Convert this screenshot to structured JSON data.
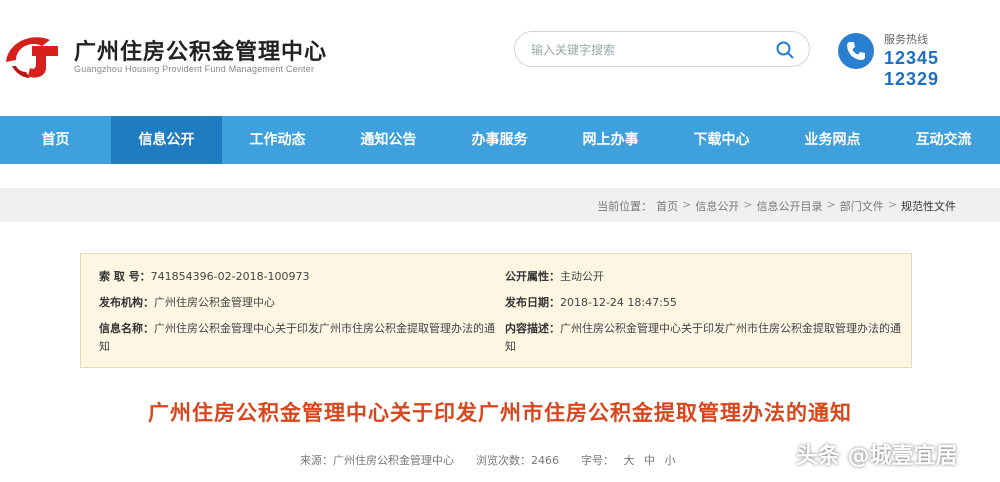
{
  "header": {
    "title": "广州住房公积金管理中心",
    "subtitle": "Guangzhou Housing Provident Fund Management Center",
    "search_placeholder": "输入关键字搜索",
    "hotline_label": "服务热线",
    "hotline_number": "12345 12329"
  },
  "nav": {
    "items": [
      "首页",
      "信息公开",
      "工作动态",
      "通知公告",
      "办事服务",
      "网上办事",
      "下载中心",
      "业务网点",
      "互动交流"
    ],
    "active": "信息公开"
  },
  "breadcrumb": {
    "prefix": "当前位置：",
    "items": [
      "首页",
      "信息公开",
      "信息公开目录",
      "部门文件",
      "规范性文件"
    ]
  },
  "info": {
    "index_label": "索 取 号：",
    "index_value": "741854396-02-2018-100973",
    "attr_label": "公开属性：",
    "attr_value": "主动公开",
    "org_label": "发布机构：",
    "org_value": "广州住房公积金管理中心",
    "date_label": "发布日期：",
    "date_value": "2018-12-24 18:47:55",
    "name_label": "信息名称：",
    "name_value": "广州住房公积金管理中心关于印发广州市住房公积金提取管理办法的通知",
    "desc_label": "内容描述：",
    "desc_value": "广州住房公积金管理中心关于印发广州市住房公积金提取管理办法的通知"
  },
  "article": {
    "title": "广州住房公积金管理中心关于印发广州市住房公积金提取管理办法的通知",
    "source": "来源：广州住房公积金管理中心",
    "views": "浏览次数：2466",
    "font_label": "字号：",
    "font_sizes": [
      "大",
      "中",
      "小"
    ]
  },
  "watermark": "头条 @城壹宜居",
  "colors": {
    "nav": "#3ea0dc",
    "nav_active": "#1f7cc0",
    "title": "#d9461c",
    "logo": "#d6201c",
    "hotline": "#1d6fc4"
  }
}
